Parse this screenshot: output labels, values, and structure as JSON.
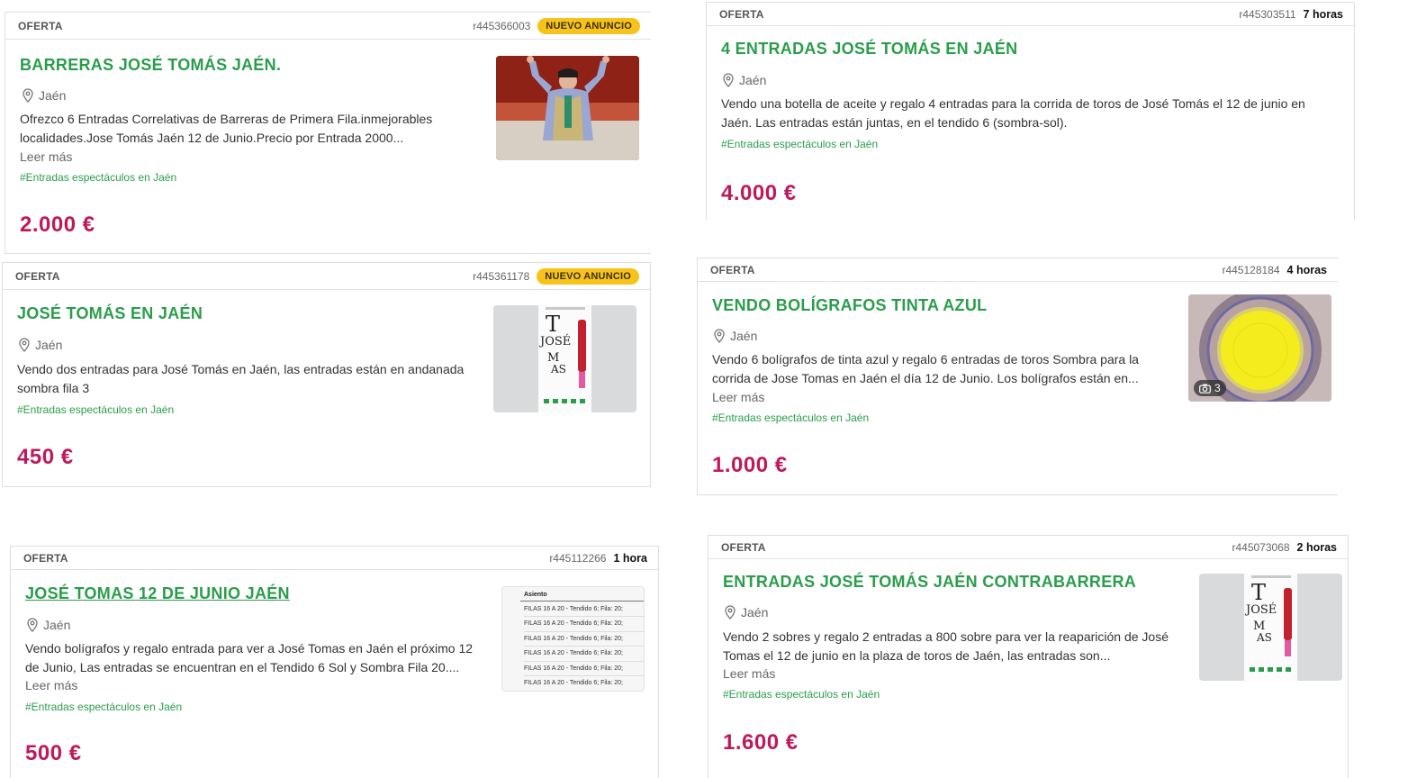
{
  "cards": [
    {
      "kind": "OFERTA",
      "ref": "r445366003",
      "badge": "NUEVO ANUNCIO",
      "title": "BARRERAS JOSÉ TOMÁS JAÉN.",
      "location": "Jaén",
      "description": "Ofrezco 6 Entradas Correlativas de Barreras de Primera Fila.inmejorables localidades.Jose Tomás Jaén 12 de Junio.Precio por Entrada 2000...",
      "more": "Leer más",
      "tag": "#Entradas espectáculos en Jaén",
      "price": "2.000 €"
    },
    {
      "kind": "OFERTA",
      "ref": "r445303511",
      "time": "7 horas",
      "title": "4 ENTRADAS JOSÉ TOMÁS EN JAÉN",
      "location": "Jaén",
      "description": "Vendo una botella de aceite y regalo 4 entradas para la corrida de toros de José Tomás el 12 de junio en Jaén. Las entradas están juntas, en el tendido 6 (sombra-sol).",
      "tag": "#Entradas espectáculos en Jaén",
      "price": "4.000 €"
    },
    {
      "kind": "OFERTA",
      "ref": "r445361178",
      "badge": "NUEVO ANUNCIO",
      "title": "JOSÉ TOMÁS EN JAÉN",
      "location": "Jaén",
      "description": "Vendo dos entradas para José Tomás en Jaén, las entradas están en andanada sombra fila 3",
      "tag": "#Entradas espectáculos en Jaén",
      "price": "450 €",
      "poster": {
        "line1": "T",
        "line2": "JOSÉ",
        "line3": "M",
        "line4": "AS"
      }
    },
    {
      "kind": "OFERTA",
      "ref": "r445128184",
      "time": "4 horas",
      "title": "VENDO BOLÍGRAFOS TINTA AZUL",
      "location": "Jaén",
      "description": "Vendo 6 bolígrafos de tinta azul y regalo 6 entradas de toros Sombra para la corrida de Jose Tomas en Jaén el día 12 de Junio. Los bolígrafos están en...",
      "more": "Leer más",
      "tag": "#Entradas espectáculos en Jaén",
      "price": "1.000 €",
      "photo_count": "3"
    },
    {
      "kind": "OFERTA",
      "ref": "r445112266",
      "time": "1 hora",
      "title": "JOSÉ TOMAS 12 DE JUNIO JAÉN",
      "location": "Jaén",
      "description": "Vendo bolígrafos y regalo entrada para ver a José Tomas en Jaén el próximo 12 de Junio, Las entradas se encuentran en el Tendido 6 Sol y Sombra Fila 20....",
      "more": "Leer más",
      "tag": "#Entradas espectáculos en Jaén",
      "price": "500 €",
      "ticket_header": "Asiento",
      "ticket_rows": [
        "FILAS 16 A 20 - Tendido 6; Fila: 20;",
        "FILAS 16 A 20 - Tendido 6; Fila: 20;",
        "FILAS 16 A 20 - Tendido 6; Fila: 20;",
        "FILAS 16 A 20 - Tendido 6; Fila: 20;",
        "FILAS 16 A 20 - Tendido 6; Fila: 20;",
        "FILAS 16 A 20 - Tendido 6; Fila: 20;"
      ]
    },
    {
      "kind": "OFERTA",
      "ref": "r445073068",
      "time": "2 horas",
      "title": "ENTRADAS JOSÉ TOMÁS JAÉN CONTRABARRERA",
      "location": "Jaén",
      "description": "Vendo 2 sobres y regalo 2 entradas a 800 sobre para ver la reaparición de José Tomas el 12 de junio en la plaza de toros de Jaén, las entradas son...",
      "more": "Leer más",
      "tag": "#Entradas espectáculos en Jaén",
      "price": "1.600 €",
      "poster": {
        "line1": "T",
        "line2": "JOSÉ",
        "line3": "M",
        "line4": "AS"
      }
    }
  ],
  "colors": {
    "title_green": "#2a9d4b",
    "price_magenta": "#c0195b",
    "badge_yellow": "#f7c31b"
  }
}
